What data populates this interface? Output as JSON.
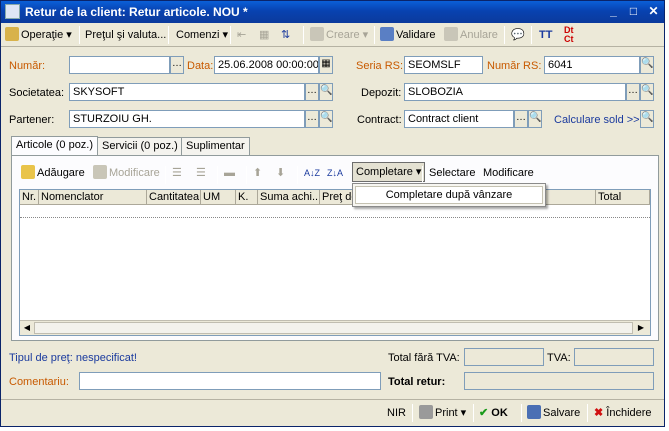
{
  "window": {
    "title": "Retur de la client: Retur articole. NOU *",
    "min": "_",
    "max": "□",
    "close": "✕"
  },
  "toolbar": {
    "operatie": "Operaţie",
    "pretul": "Preţul şi valuta...",
    "comenzi": "Comenzi",
    "creare": "Creare",
    "validare": "Validare",
    "anulare": "Anulare"
  },
  "form": {
    "numar_label": "Număr:",
    "numar_value": "",
    "data_label": "Data:",
    "data_value": "25.06.2008 00:00:00",
    "seria_label": "Seria RS:",
    "seria_value": "SEOMSLF",
    "nrrs_label": "Număr RS:",
    "nrrs_value": "6041",
    "soc_label": "Societatea:",
    "soc_value": "SKYSOFT",
    "depozit_label": "Depozit:",
    "depozit_value": "SLOBOZIA",
    "partener_label": "Partener:",
    "partener_value": "STURZOIU GH.",
    "contract_label": "Contract:",
    "contract_value": "Contract client",
    "calc_link": "Calculare sold >>"
  },
  "tabs": [
    "Articole (0 poz.)",
    "Servicii (0 poz.)",
    "Suplimentar"
  ],
  "grid_toolbar": {
    "adaugare": "Adăugare",
    "modificare": "Modificare",
    "completare": "Completare",
    "selectare": "Selectare",
    "modificare2": "Modificare"
  },
  "columns": [
    "Nr.",
    "Nomenclator",
    "Cantitatea",
    "UM",
    "K.",
    "Suma achi...",
    "Preţ de",
    "Total"
  ],
  "dropdown": {
    "item": "Completare după vânzare"
  },
  "footer": {
    "tip_pret": "Tipul de preţ: nespecificat!",
    "total_fara": "Total fără TVA:",
    "tva": "TVA:",
    "comentariu": "Comentariu:",
    "total_retur": "Total retur:"
  },
  "bottom": {
    "nir": "NIR",
    "print": "Print",
    "ok": "OK",
    "salvare": "Salvare",
    "inchidere": "Închidere"
  }
}
